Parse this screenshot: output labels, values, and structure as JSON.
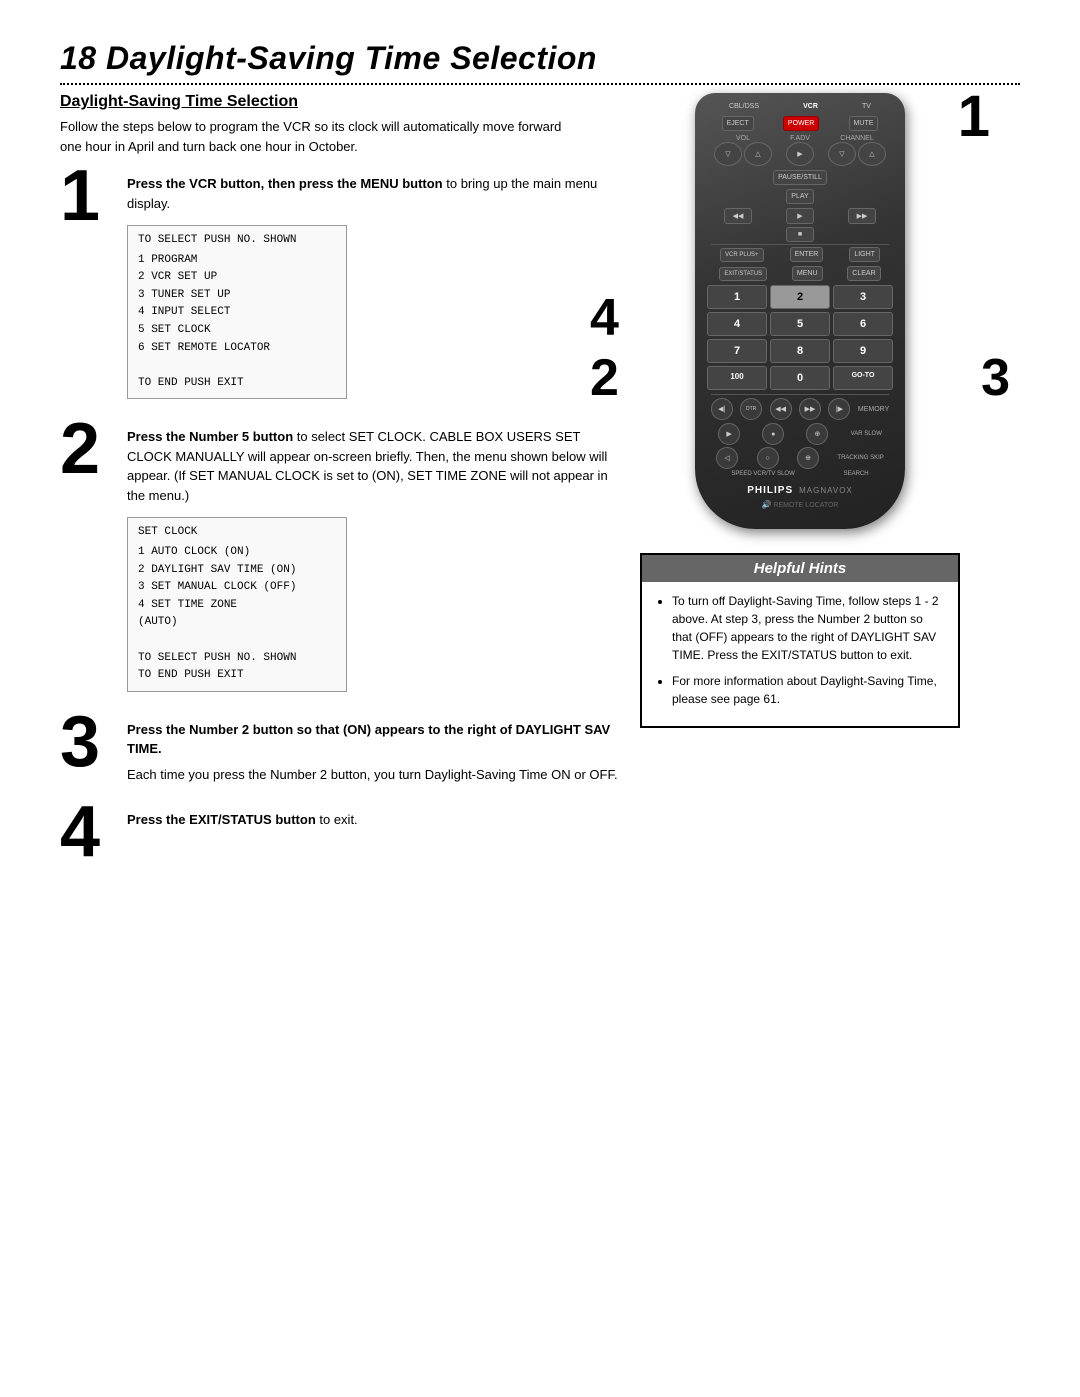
{
  "page": {
    "chapter": "18",
    "title": "Daylight-Saving Time Selection",
    "section_title": "Daylight-Saving Time Selection",
    "intro": "Follow the steps below to program the VCR so its clock will automatically move forward one hour in April and turn back one hour in October.",
    "dotted_separator": true
  },
  "steps": [
    {
      "number": "1",
      "instruction_bold": "Press the VCR button, then press the MENU button",
      "instruction_rest": " to bring up the main menu display.",
      "menu": {
        "title": "TO SELECT PUSH NO. SHOWN",
        "items": [
          "1  PROGRAM",
          "2  VCR SET UP",
          "3  TUNER SET UP",
          "4  INPUT SELECT",
          "5  SET CLOCK",
          "6  SET REMOTE LOCATOR"
        ],
        "footer": "TO END PUSH EXIT"
      }
    },
    {
      "number": "2",
      "instruction_bold": "Press the Number 5 button",
      "instruction_rest": " to select SET CLOCK. CABLE BOX USERS SET CLOCK MANUALLY will appear on-screen briefly. Then, the menu shown below will appear. (If SET MANUAL CLOCK is set to (ON), SET TIME ZONE will not appear in the menu.)",
      "menu": {
        "title": "SET CLOCK",
        "items": [
          "1  AUTO CLOCK        (ON)",
          "2  DAYLIGHT SAV TIME (ON)",
          "3  SET MANUAL CLOCK  (OFF)",
          "4  SET TIME ZONE",
          "    (AUTO)"
        ],
        "footer": "TO SELECT PUSH NO. SHOWN\nTO END PUSH EXIT"
      }
    },
    {
      "number": "3",
      "instruction_bold": "Press the Number 2 button so that (ON) appears to the right of DAYLIGHT SAV TIME.",
      "instruction_rest": "",
      "extra": "Each time you press the Number 2 button, you turn Daylight-Saving Time ON or OFF."
    },
    {
      "number": "4",
      "instruction_bold": "Press the EXIT/STATUS button",
      "instruction_rest": " to exit."
    }
  ],
  "remote": {
    "source_buttons": [
      "CBL/DSS",
      "VCR",
      "TV"
    ],
    "top_buttons": [
      "EJECT",
      "POWER",
      "MUTE"
    ],
    "vol_fadv_channel": [
      "VOL",
      "F.ADV",
      "CHANNEL"
    ],
    "pause_still": "PAUSE/STILL",
    "play": "PLAY",
    "transport": [
      "REW",
      "PLAY",
      "FF"
    ],
    "vcr_plus": "VCR PLUS+",
    "enter": "ENTER",
    "stop": "STOP",
    "light": "LIGHT",
    "exit_status": "EXIT/STATUS",
    "menu": "MENU",
    "clear": "CLEAR",
    "numpad": [
      "1",
      "2",
      "3",
      "4",
      "5",
      "6",
      "7",
      "8",
      "9",
      "100",
      "0",
      "GO-TO"
    ],
    "highlighted_num": "2",
    "brand": "PHILIPS",
    "brand2": "MAGNAVOX",
    "remote_locator": "REMOTE LOCATOR",
    "memory": "MEMORY",
    "var_slow": "VAR SLOW",
    "tracking_skip": "TRACKING SKIP",
    "speed_vcr_tv": "SPEED VCR/TV SLOW",
    "search": "SEARCH"
  },
  "hints": {
    "title": "Helpful Hints",
    "items": [
      "To turn off Daylight-Saving Time, follow steps 1 - 2 above. At step 3, press the Number 2 button so that (OFF) appears to the right of DAYLIGHT SAV TIME. Press the EXIT/STATUS button to exit.",
      "For more information about Daylight-Saving Time, please see page 61."
    ]
  },
  "overlay_numbers": {
    "top_right": "1",
    "left_mid": "4",
    "left_mid2": "2",
    "right_mid": "3"
  }
}
